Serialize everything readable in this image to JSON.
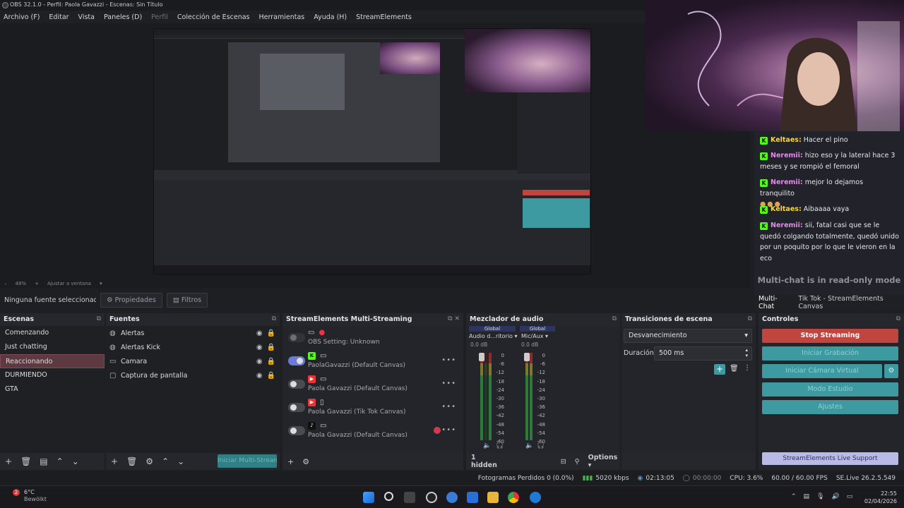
{
  "window": {
    "title": "OBS 32.1.0 - Perfil: Paola Gavazzi - Escenas: Sin Título"
  },
  "menu": [
    "Archivo (F)",
    "Editar",
    "Vista",
    "Paneles (D)",
    "Perfil",
    "Colección de Escenas",
    "Herramientas",
    "Ayuda (H)",
    "StreamElements"
  ],
  "zoom": {
    "level": "48%",
    "fit": "Ajustar a ventana"
  },
  "chat": {
    "messages": [
      {
        "user": "Keltaes:",
        "text": "Hacer el pino",
        "style": "k"
      },
      {
        "user": "Neremii:",
        "text": "hizo eso y la lateral hace 3 meses y se rompió el femoral",
        "style": "n"
      },
      {
        "user": "Neremii:",
        "text": "mejor lo dejamos tranquilito",
        "style": "n"
      },
      {
        "user": "Keltaes:",
        "text": "Aibaaaa vaya",
        "style": "k"
      },
      {
        "user": "Neremii:",
        "text": "sii, fatal casi que se le quedó colgando totalmente, quedó unido por un poquito por lo que le vieron en la eco",
        "style": "n"
      }
    ],
    "readonly": "Multi-chat is in read-only mode",
    "tabs": [
      "Multi-Chat",
      "Tik Tok - StreamElements Canvas"
    ]
  },
  "props": {
    "no_source": "Ninguna fuente seleccionada",
    "properties": "Propiedades",
    "filters": "Filtros"
  },
  "scenes": {
    "title": "Escenas",
    "items": [
      "Comenzando",
      "Just chatting",
      "Reaccionando",
      "DURMIENDO",
      "GTA"
    ],
    "active_index": 2
  },
  "sources": {
    "title": "Fuentes",
    "items": [
      "Alertas",
      "Alertas Kick",
      "Camara",
      "Captura de pantalla"
    ]
  },
  "multistream": {
    "title": "StreamElements Multi-Streaming",
    "rows": [
      {
        "label": "OBS Setting: Unknown",
        "on": false
      },
      {
        "label": "PaolaGavazzi (Default Canvas)",
        "on": true
      },
      {
        "label": "Paola Gavazzi (Default Canvas)",
        "on": false
      },
      {
        "label": "Paola Gavazzi (Tik Tok Canvas)",
        "on": false
      },
      {
        "label": "Paola Gavazzi (Default Canvas)",
        "on": false
      }
    ],
    "button": "Iniciar Multi-Streaming"
  },
  "mixer": {
    "title": "Mezclador de audio",
    "channels": [
      {
        "name": "Audio d...ritorio",
        "db": "0.0 dB",
        "tag": "Global"
      },
      {
        "name": "Mic/Aux",
        "db": "0.0 dB",
        "tag": "Global"
      }
    ],
    "ticks": [
      "0",
      "-6",
      "-12",
      "-18",
      "-24",
      "-30",
      "-36",
      "-42",
      "-48",
      "-54",
      "-60"
    ],
    "hidden": "1 hidden",
    "options": "Options"
  },
  "transitions": {
    "title": "Transiciones de escena",
    "selected": "Desvanecimiento",
    "duration_label": "Duración",
    "duration": "500 ms"
  },
  "controls": {
    "title": "Controles",
    "buttons": [
      "Stop Streaming",
      "Iniciar Grabación",
      "Iniciar Cámara Virtual",
      "Modo Estudio",
      "Ajustes"
    ],
    "support": "StreamElements Live Support"
  },
  "status": {
    "dropped": "Fotogramas Perdidos 0 (0.0%)",
    "bitrate": "5020 kbps",
    "live_time": "02:13:05",
    "rec_time": "00:00:00",
    "cpu": "CPU: 3.6%",
    "fps": "60.00 / 60.00 FPS",
    "version": "SE.Live 26.2.5.549"
  },
  "taskbar": {
    "weather_temp": "6°C",
    "weather_desc": "Bewölkt",
    "weather_badge": "2",
    "time": "22:55",
    "date": "02/04/2026"
  },
  "colors": {
    "accent_teal": "#3c9aa0",
    "stop_red": "#c0453e",
    "active_scene": "#5d3a42",
    "kick_green": "#53fc18"
  }
}
